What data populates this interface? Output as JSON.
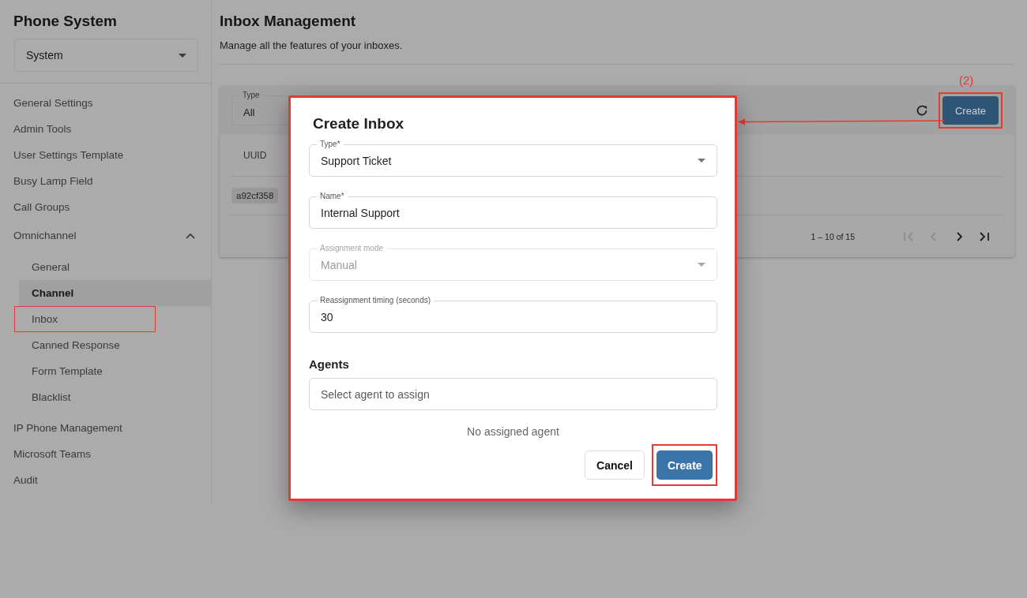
{
  "sidebar": {
    "title": "Phone System",
    "system_select": {
      "value": "System"
    },
    "items": [
      {
        "label": "General Settings"
      },
      {
        "label": "Admin Tools"
      },
      {
        "label": "User Settings Template"
      },
      {
        "label": "Busy Lamp Field"
      },
      {
        "label": "Call Groups"
      },
      {
        "label": "Omnichannel",
        "expanded": true,
        "children": [
          {
            "label": "General",
            "selected": false,
            "annotated": false
          },
          {
            "label": "Channel",
            "selected": true,
            "annotated": false
          },
          {
            "label": "Inbox",
            "selected": false,
            "annotated": true
          },
          {
            "label": "Canned Response",
            "selected": false,
            "annotated": false
          },
          {
            "label": "Form Template",
            "selected": false,
            "annotated": false
          },
          {
            "label": "Blacklist",
            "selected": false,
            "annotated": false
          }
        ]
      },
      {
        "label": "IP Phone Management"
      },
      {
        "label": "Microsoft Teams"
      },
      {
        "label": "Audit"
      }
    ]
  },
  "main": {
    "title": "Inbox Management",
    "subtitle": "Manage all the features of your inboxes.",
    "filter": {
      "label": "Type",
      "value": "All"
    },
    "create_button": {
      "label": "Create",
      "annotated": true
    },
    "table": {
      "columns": [
        "UUID"
      ],
      "rows": [
        {
          "uuid": "a92cf358"
        }
      ]
    },
    "pagination": {
      "range": "1 – 10 of 15",
      "buttons": [
        {
          "kind": "first",
          "disabled": true
        },
        {
          "kind": "prev",
          "disabled": true
        },
        {
          "kind": "next",
          "disabled": false
        },
        {
          "kind": "last",
          "disabled": false
        }
      ]
    }
  },
  "annotation": {
    "step_label": "(2)"
  },
  "dialog": {
    "title": "Create Inbox",
    "annotated": true,
    "fields": [
      {
        "kind": "select",
        "label": "Type*",
        "value": "Support Ticket",
        "disabled": false
      },
      {
        "kind": "text",
        "label": "Name*",
        "value": "Internal Support",
        "disabled": false
      },
      {
        "kind": "select",
        "label": "Assignment mode",
        "value": "Manual",
        "disabled": true
      },
      {
        "kind": "text",
        "label": "Reassignment timing (seconds)",
        "value": "30",
        "disabled": false
      }
    ],
    "agents": {
      "heading": "Agents",
      "placeholder": "Select agent to assign",
      "empty_text": "No assigned agent"
    },
    "buttons": [
      {
        "kind": "secondary",
        "label": "Cancel",
        "annotated": false
      },
      {
        "kind": "primary",
        "label": "Create",
        "annotated": true
      }
    ]
  }
}
